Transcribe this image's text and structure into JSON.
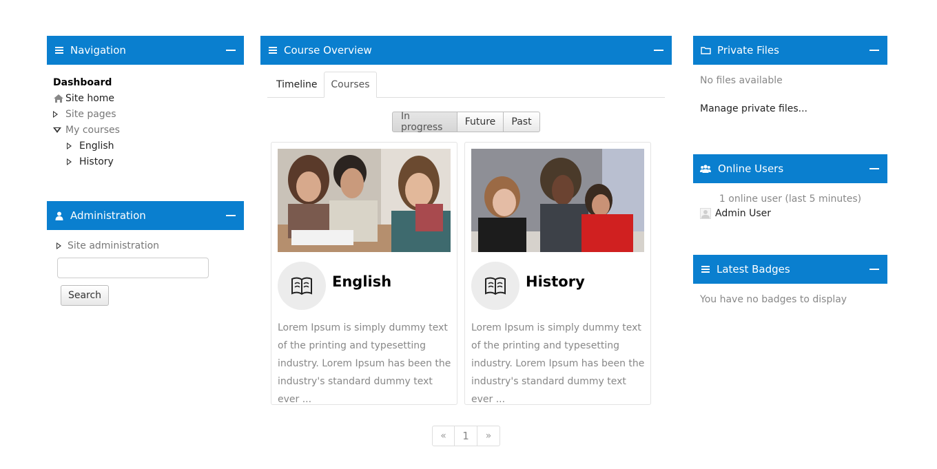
{
  "navigation": {
    "title": "Navigation",
    "items": [
      {
        "label": "Dashboard"
      },
      {
        "label": "Site home"
      },
      {
        "label": "Site pages"
      },
      {
        "label": "My courses"
      },
      {
        "label": "English"
      },
      {
        "label": "History"
      }
    ]
  },
  "administration": {
    "title": "Administration",
    "site_admin_label": "Site administration",
    "search_value": "",
    "search_button": "Search"
  },
  "overview": {
    "title": "Course Overview",
    "tabs": [
      {
        "label": "Timeline"
      },
      {
        "label": "Courses"
      }
    ],
    "active_tab": "Courses",
    "filters": [
      {
        "label": "In progress"
      },
      {
        "label": "Future"
      },
      {
        "label": "Past"
      }
    ],
    "active_filter": "In progress",
    "courses": [
      {
        "name": "English",
        "description": "Lorem Ipsum is simply dummy text of the printing and typesetting industry. Lorem Ipsum has been the industry's standard dummy text ever ..."
      },
      {
        "name": "History",
        "description": "Lorem Ipsum is simply dummy text of the printing and typesetting industry. Lorem Ipsum has been the industry's standard dummy text ever ..."
      }
    ],
    "pager": {
      "prev": "«",
      "page": "1",
      "next": "»"
    }
  },
  "private_files": {
    "title": "Private Files",
    "empty_text": "No files available",
    "manage_link": "Manage private files..."
  },
  "online_users": {
    "title": "Online Users",
    "summary": "1 online user (last 5 minutes)",
    "users": [
      {
        "name": "Admin User"
      }
    ]
  },
  "latest_badges": {
    "title": "Latest Badges",
    "empty_text": "You have no badges to display"
  },
  "colors": {
    "header_bg": "#0a7fcf",
    "header_text": "#ffffff",
    "muted_text": "#888888"
  },
  "icons": {
    "navigation": "hamburger-icon",
    "administration": "user-icon",
    "course_overview": "hamburger-icon",
    "private_files": "folder-icon",
    "online_users": "users-icon",
    "latest_badges": "hamburger-icon",
    "site_home": "home-icon",
    "course": "book-icon"
  }
}
